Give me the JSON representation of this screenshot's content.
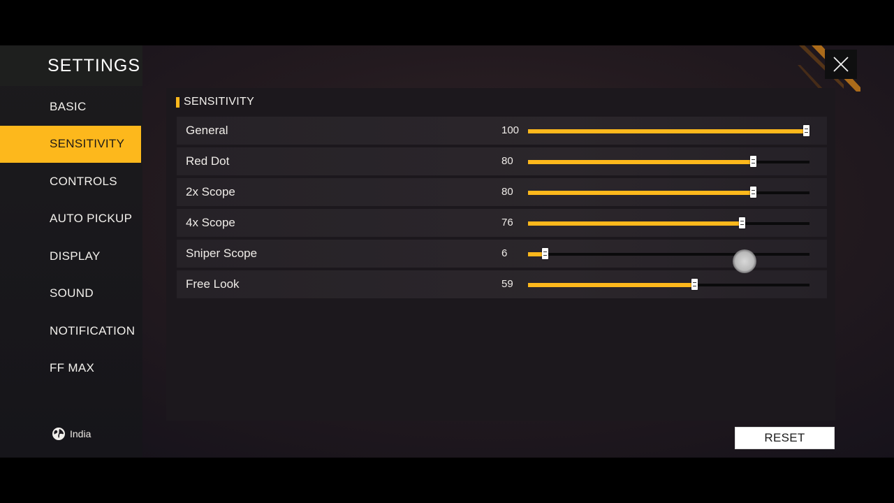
{
  "sidebar": {
    "title": "SETTINGS",
    "items": [
      {
        "label": "BASIC",
        "active": false
      },
      {
        "label": "SENSITIVITY",
        "active": true
      },
      {
        "label": "CONTROLS",
        "active": false
      },
      {
        "label": "AUTO PICKUP",
        "active": false
      },
      {
        "label": "DISPLAY",
        "active": false
      },
      {
        "label": "SOUND",
        "active": false
      },
      {
        "label": "NOTIFICATION",
        "active": false
      },
      {
        "label": "FF MAX",
        "active": false
      }
    ],
    "region": {
      "icon": "globe-icon",
      "label": "India"
    }
  },
  "header": {
    "close_icon": "close-icon"
  },
  "panel": {
    "section_title": "SENSITIVITY",
    "rows": [
      {
        "label": "General",
        "value": 100
      },
      {
        "label": "Red Dot",
        "value": 80
      },
      {
        "label": "2x Scope",
        "value": 80
      },
      {
        "label": "4x Scope",
        "value": 76
      },
      {
        "label": "Sniper Scope",
        "value": 6
      },
      {
        "label": "Free Look",
        "value": 59
      }
    ],
    "slider_max": 100
  },
  "footer": {
    "reset_label": "RESET"
  },
  "colors": {
    "accent": "#fdb81c",
    "panel": "#1c181d",
    "sidebar": "#1c1b1d"
  }
}
